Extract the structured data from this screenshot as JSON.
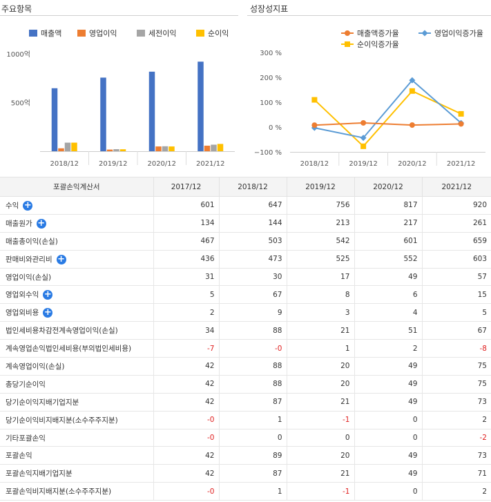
{
  "left_panel": {
    "title": "주요항목"
  },
  "right_panel": {
    "title": "성장성지표"
  },
  "chart_data": [
    {
      "type": "bar",
      "title": "",
      "categories": [
        "2018/12",
        "2019/12",
        "2020/12",
        "2021/12"
      ],
      "series": [
        {
          "name": "매출액",
          "color": "#4472c4",
          "values": [
            647,
            756,
            817,
            920
          ]
        },
        {
          "name": "영업이익",
          "color": "#ed7d31",
          "values": [
            30,
            17,
            49,
            57
          ]
        },
        {
          "name": "세전이익",
          "color": "#a5a5a5",
          "values": [
            88,
            21,
            51,
            67
          ]
        },
        {
          "name": "순이익",
          "color": "#ffc000",
          "values": [
            88,
            20,
            49,
            75
          ]
        }
      ],
      "ylim": [
        0,
        1000
      ],
      "yticks": [
        {
          "value": 500,
          "label": "500억"
        },
        {
          "value": 1000,
          "label": "1000억"
        }
      ],
      "legend": "top",
      "grid": false
    },
    {
      "type": "line",
      "title": "",
      "categories": [
        "2018/12",
        "2019/12",
        "2020/12",
        "2021/12"
      ],
      "series": [
        {
          "name": "매출액증가율",
          "color": "#ed7d31",
          "marker": "circle",
          "values": [
            7.6,
            16.8,
            8.1,
            12.6
          ]
        },
        {
          "name": "영업이익증가율",
          "color": "#5b9bd5",
          "marker": "diamond",
          "values": [
            -3.2,
            -43.3,
            188.2,
            16.3
          ]
        },
        {
          "name": "순이익증가율",
          "color": "#ffc000",
          "marker": "square",
          "values": [
            109.5,
            -77.3,
            145.0,
            53.1
          ]
        }
      ],
      "ylim": [
        -100,
        300
      ],
      "yticks": [
        {
          "value": 300,
          "label": "300 %"
        },
        {
          "value": 200,
          "label": "200 %"
        },
        {
          "value": 100,
          "label": "100 %"
        },
        {
          "value": 0,
          "label": "0 %"
        },
        {
          "value": -100,
          "label": "−100 %"
        }
      ],
      "legend": "top",
      "grid": false
    }
  ],
  "table": {
    "headers": [
      "포괄손익계산서",
      "2017/12",
      "2018/12",
      "2019/12",
      "2020/12",
      "2021/12"
    ],
    "rows": [
      {
        "label": "수익",
        "expand": true,
        "indent": false,
        "values": [
          "601",
          "647",
          "756",
          "817",
          "920"
        ]
      },
      {
        "label": "매출원가",
        "expand": true,
        "indent": false,
        "values": [
          "134",
          "144",
          "213",
          "217",
          "261"
        ]
      },
      {
        "label": "매출총이익(손실)",
        "expand": false,
        "indent": false,
        "values": [
          "467",
          "503",
          "542",
          "601",
          "659"
        ]
      },
      {
        "label": "판매비와관리비",
        "expand": true,
        "indent": false,
        "values": [
          "436",
          "473",
          "525",
          "552",
          "603"
        ]
      },
      {
        "label": "영업이익(손실)",
        "expand": false,
        "indent": false,
        "values": [
          "31",
          "30",
          "17",
          "49",
          "57"
        ]
      },
      {
        "label": "영업외수익",
        "expand": true,
        "indent": false,
        "values": [
          "5",
          "67",
          "8",
          "6",
          "15"
        ]
      },
      {
        "label": "영업외비용",
        "expand": true,
        "indent": false,
        "values": [
          "2",
          "9",
          "3",
          "4",
          "5"
        ]
      },
      {
        "label": "법인세비용차감전계속영업이익(손실)",
        "expand": false,
        "indent": false,
        "values": [
          "34",
          "88",
          "21",
          "51",
          "67"
        ]
      },
      {
        "label": "계속영업손익법인세비용(부의법인세비용)",
        "expand": false,
        "indent": false,
        "values": [
          "-7",
          "-0",
          "1",
          "2",
          "-8"
        ]
      },
      {
        "label": "계속영업이익(손실)",
        "expand": false,
        "indent": false,
        "values": [
          "42",
          "88",
          "20",
          "49",
          "75"
        ]
      },
      {
        "label": "총당기순이익",
        "expand": false,
        "indent": false,
        "values": [
          "42",
          "88",
          "20",
          "49",
          "75"
        ]
      },
      {
        "label": "당기순이익지배기업지분",
        "expand": false,
        "indent": true,
        "values": [
          "42",
          "87",
          "21",
          "49",
          "73"
        ]
      },
      {
        "label": "당기순이익비지배지분(소수주주지분)",
        "expand": false,
        "indent": true,
        "values": [
          "-0",
          "1",
          "-1",
          "0",
          "2"
        ]
      },
      {
        "label": "기타포괄손익",
        "expand": false,
        "indent": false,
        "values": [
          "-0",
          "0",
          "0",
          "0",
          "-2"
        ]
      },
      {
        "label": "포괄손익",
        "expand": false,
        "indent": false,
        "values": [
          "42",
          "89",
          "20",
          "49",
          "73"
        ]
      },
      {
        "label": "포괄손익지배기업지분",
        "expand": false,
        "indent": true,
        "values": [
          "42",
          "87",
          "21",
          "49",
          "71"
        ]
      },
      {
        "label": "포괄손익비지배지분(소수주주지분)",
        "expand": false,
        "indent": true,
        "values": [
          "-0",
          "1",
          "-1",
          "0",
          "2"
        ]
      }
    ]
  }
}
